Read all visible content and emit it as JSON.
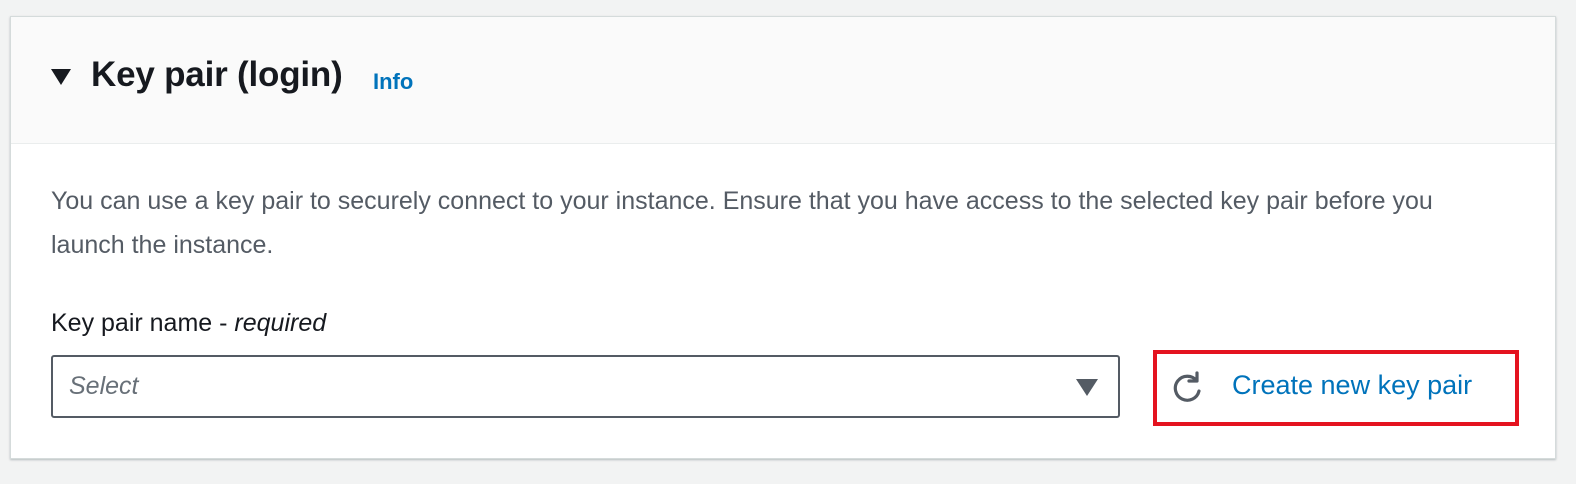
{
  "panel": {
    "title": "Key pair (login)",
    "info_link": "Info",
    "description": "You can use a key pair to securely connect to your instance. Ensure that you have access to the selected key pair before you launch the instance."
  },
  "key_pair_field": {
    "label": "Key pair name - ",
    "required_text": "required",
    "placeholder": "Select"
  },
  "actions": {
    "refresh_icon": "refresh-icon",
    "create_label": "Create new key pair"
  },
  "colors": {
    "link": "#0073bb",
    "highlight": "#e4131f",
    "text_primary": "#16191f",
    "text_secondary": "#545b64"
  }
}
